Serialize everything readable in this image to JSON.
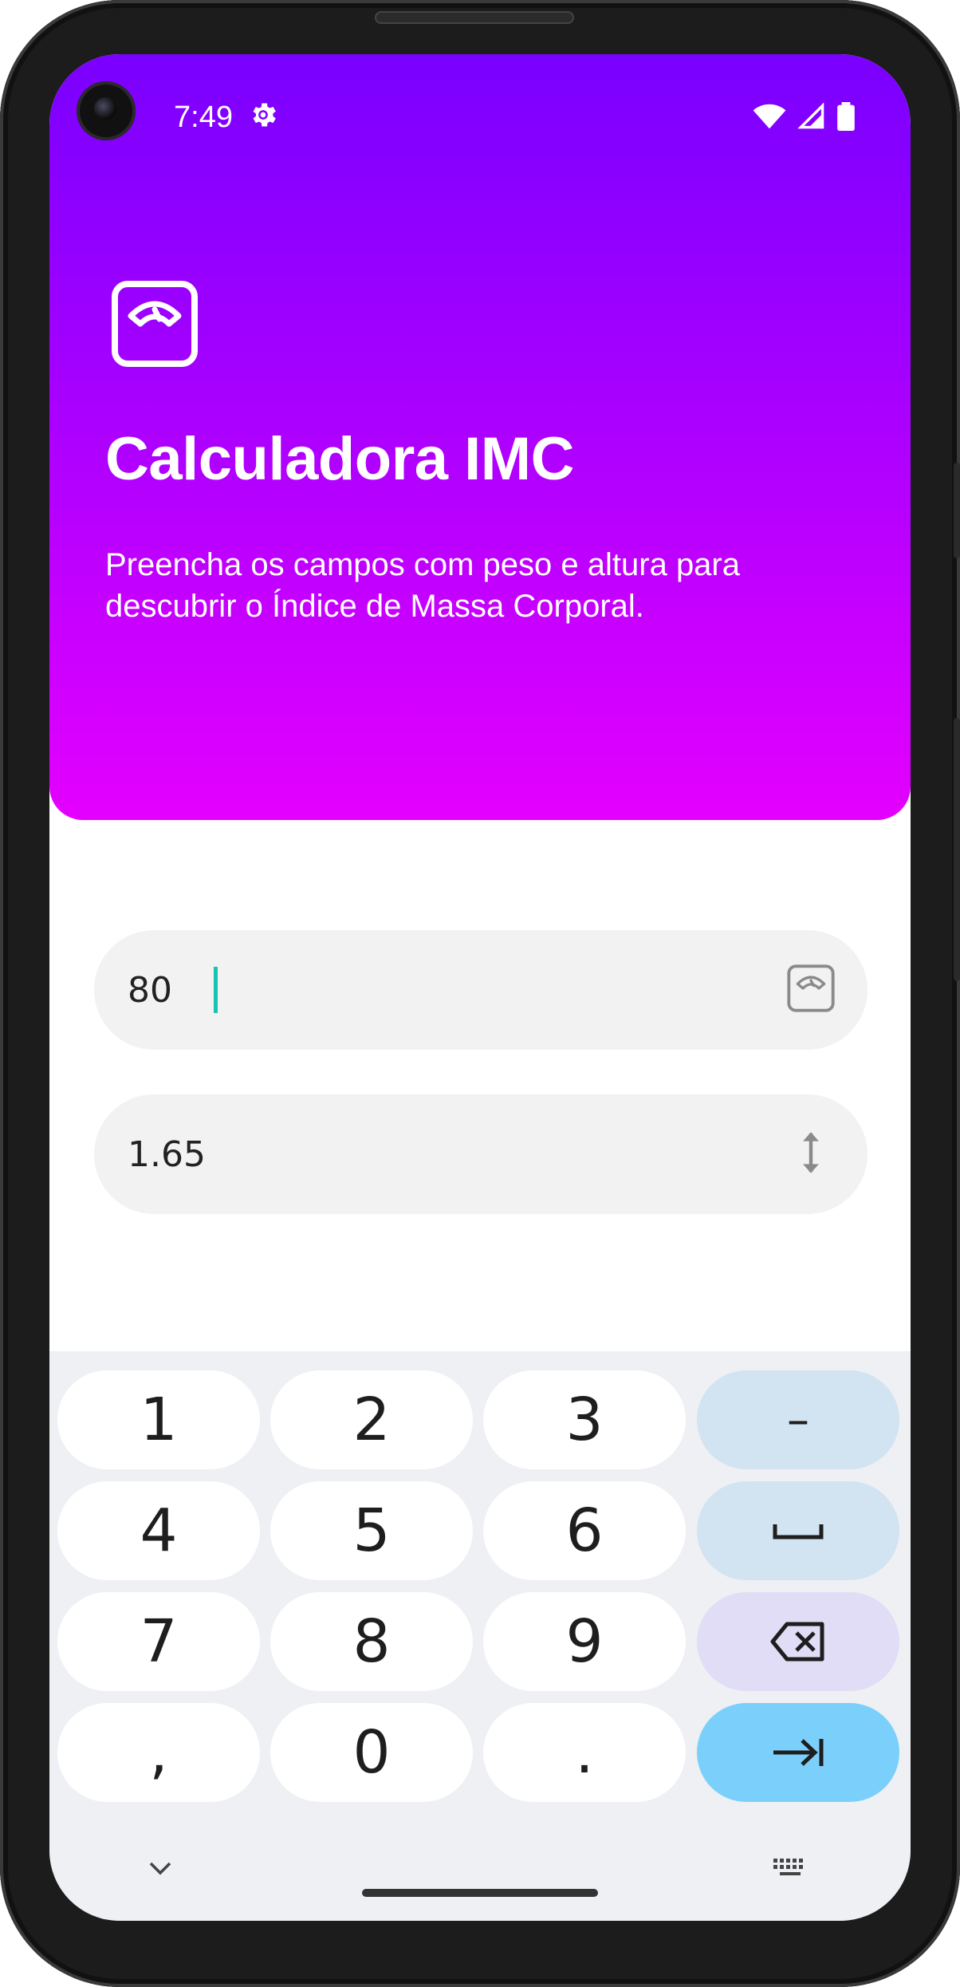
{
  "status_bar": {
    "time": "7:49"
  },
  "header": {
    "title": "Calculadora IMC",
    "description": "Preencha os campos com peso e altura para descubrir o Índice de Massa Corporal."
  },
  "fields": {
    "weight": {
      "value": "80",
      "icon": "scale-icon"
    },
    "height": {
      "value": "1.65",
      "icon": "height-arrows-icon"
    }
  },
  "keyboard": {
    "keys": {
      "k1": "1",
      "k2": "2",
      "k3": "3",
      "k4": "4",
      "k5": "5",
      "k6": "6",
      "k7": "7",
      "k8": "8",
      "k9": "9",
      "comma": ",",
      "k0": "0",
      "period": ".",
      "minus": "–"
    }
  },
  "colors": {
    "header_gradient_top": "#7a00ff",
    "header_gradient_bottom": "#e400ff",
    "cursor": "#18c2b5",
    "enter_key": "#7bd0fb",
    "symbol_key": "#d2e3f2",
    "delete_key": "#e2ddf7"
  }
}
